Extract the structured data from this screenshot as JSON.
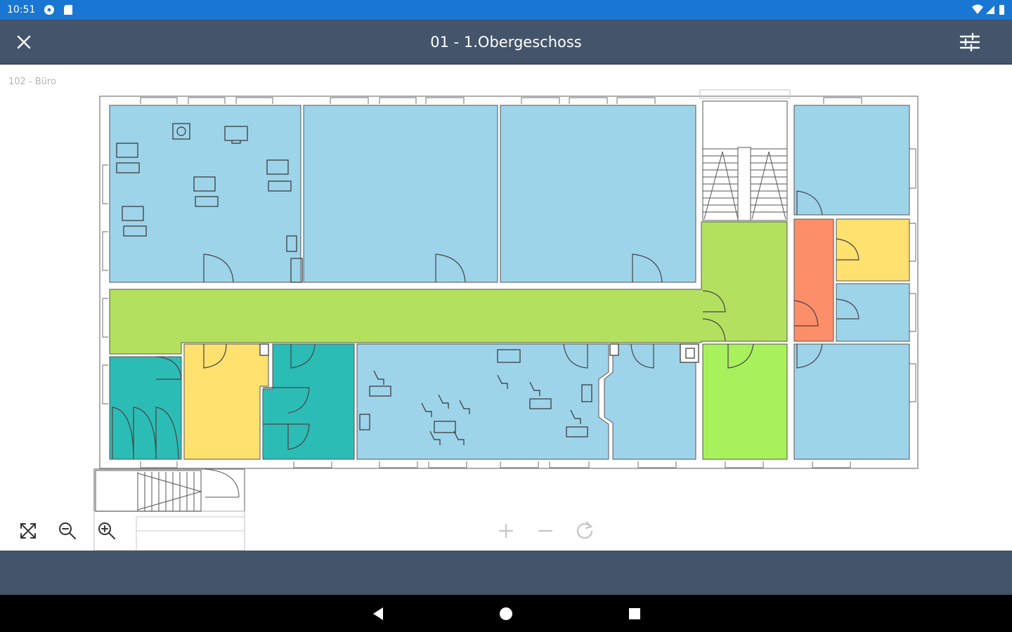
{
  "status": {
    "time": "10:51"
  },
  "appbar": {
    "title": "01 - 1.Obergeschoss",
    "close_icon": "close-icon",
    "filter_icon": "tune-icon"
  },
  "plan": {
    "selected_room": "102 - Büro"
  },
  "controls": {
    "fit_icon": "fit-screen-icon",
    "zoom_out_icon": "zoom-out-icon",
    "zoom_in_icon": "zoom-in-icon",
    "plus_icon": "plus-icon",
    "minus_icon": "minus-icon",
    "refresh_icon": "refresh-icon"
  },
  "colors": {
    "statusbar": "#1976d2",
    "appbar": "#44546a",
    "office": "#9ed4ea",
    "corridor": "#b4e060",
    "green_bright": "#a8f05c",
    "teal": "#2cbcb6",
    "yellow": "#ffe170",
    "orange": "#fd8e6a"
  },
  "navbar": {
    "back_icon": "back-icon",
    "home_icon": "home-icon",
    "recents_icon": "recents-icon"
  }
}
